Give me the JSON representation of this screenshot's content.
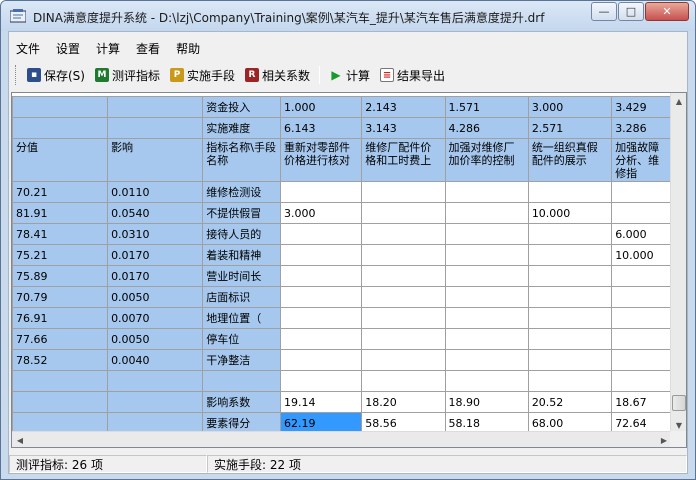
{
  "window": {
    "title": "DINA满意度提升系统 - D:\\lzj\\Company\\Training\\案例\\某汽车_提升\\某汽车售后满意度提升.drf",
    "minimize": "—",
    "maximize": "□",
    "close": "✕"
  },
  "menu": [
    "文件",
    "设置",
    "计算",
    "查看",
    "帮助"
  ],
  "toolbar": {
    "save": "保存(S)",
    "indicators": "测评指标",
    "measures": "实施手段",
    "correlation": "相关系数",
    "calculate": "计算",
    "export": "结果导出"
  },
  "grid": {
    "top_rows": [
      [
        "",
        "",
        "资金投入",
        "1.000",
        "2.143",
        "1.571",
        "3.000",
        "3.429"
      ],
      [
        "",
        "",
        "实施难度",
        "6.143",
        "3.143",
        "4.286",
        "2.571",
        "3.286"
      ]
    ],
    "header": [
      "分值",
      "影响",
      "指标名称\\手段名称",
      "重新对零部件价格进行核对",
      "维修厂配件价格和工时费上",
      "加强对维修厂加价率的控制",
      "统一组织真假配件的展示",
      "加强故障分析、维修指"
    ],
    "rows": [
      [
        "70.21",
        "0.0110",
        "维修检测设",
        "",
        "",
        "",
        "",
        ""
      ],
      [
        "81.91",
        "0.0540",
        "不提供假冒",
        "3.000",
        "",
        "",
        "10.000",
        ""
      ],
      [
        "78.41",
        "0.0310",
        "接待人员的",
        "",
        "",
        "",
        "",
        "6.000"
      ],
      [
        "75.21",
        "0.0170",
        "着装和精神",
        "",
        "",
        "",
        "",
        "10.000"
      ],
      [
        "75.89",
        "0.0170",
        "营业时间长",
        "",
        "",
        "",
        "",
        ""
      ],
      [
        "70.79",
        "0.0050",
        "店面标识",
        "",
        "",
        "",
        "",
        ""
      ],
      [
        "76.91",
        "0.0070",
        "地理位置（",
        "",
        "",
        "",
        "",
        ""
      ],
      [
        "77.66",
        "0.0050",
        "停车位",
        "",
        "",
        "",
        "",
        ""
      ],
      [
        "78.52",
        "0.0040",
        "干净整洁",
        "",
        "",
        "",
        "",
        ""
      ],
      [
        "",
        "",
        "",
        "",
        "",
        "",
        "",
        ""
      ]
    ],
    "bottom_rows": [
      [
        "",
        "",
        "影响系数",
        "19.14",
        "18.20",
        "18.90",
        "20.52",
        "18.67"
      ],
      [
        "",
        "",
        "要素得分",
        "62.19",
        "58.56",
        "58.18",
        "68.00",
        "72.64"
      ]
    ]
  },
  "status": {
    "indicators": "测评指标: 26 项",
    "measures": "实施手段: 22 项"
  }
}
